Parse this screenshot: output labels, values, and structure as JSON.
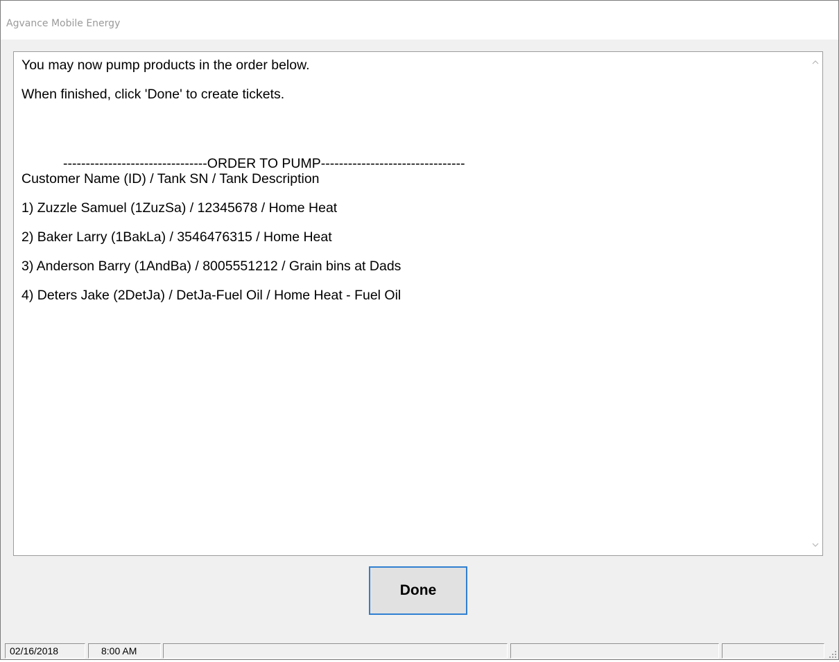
{
  "window": {
    "title": "Agvance Mobile Energy"
  },
  "message": {
    "lines": [
      "You may now pump products in the order below.",
      "When finished, click 'Done' to create tickets.",
      "--------------------------------ORDER TO PUMP--------------------------------",
      "Customer Name (ID) / Tank SN / Tank Description",
      "1) Zuzzle Samuel (1ZuzSa) / 12345678 / Home Heat",
      "2) Baker Larry (1BakLa) / 3546476315 / Home Heat",
      "3) Anderson Barry (1AndBa) / 8005551212 / Grain bins at Dads",
      "4) Deters Jake (2DetJa) / DetJa-Fuel Oil / Home Heat - Fuel Oil"
    ]
  },
  "scrollbar": {
    "up_icon": "chevron-up-icon",
    "down_icon": "chevron-down-icon"
  },
  "done_button": {
    "label": "Done"
  },
  "statusbar": {
    "date": "02/16/2018",
    "time": "8:00 AM",
    "panel3": "",
    "panel4": "",
    "panel5": ""
  },
  "colors": {
    "button_focus_border": "#2f7fd1",
    "window_bg": "#f0f0f0"
  }
}
